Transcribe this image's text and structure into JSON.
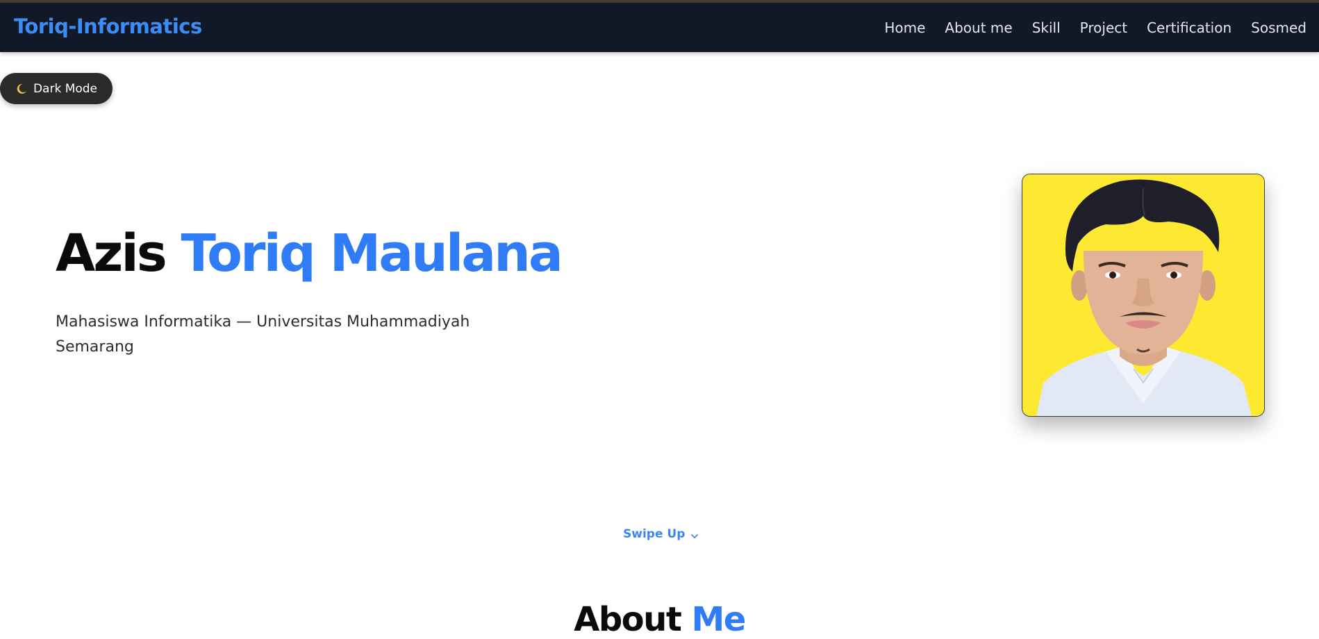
{
  "navbar": {
    "brand": "Toriq-Informatics",
    "links": [
      "Home",
      "About me",
      "Skill",
      "Project",
      "Certification",
      "Sosmed"
    ]
  },
  "theme_toggle": {
    "label": "Dark Mode",
    "icon": "moon-icon"
  },
  "hero": {
    "first_name": "Azis",
    "last_name": "Toriq Maulana",
    "subtitle": "Mahasiswa Informatika — Universitas Muhammadiyah Semarang",
    "photo_icon": "profile-photo"
  },
  "swipe": {
    "label": "Swipe Up",
    "icon": "chevron-down-icon"
  },
  "about": {
    "title_part1": "About",
    "title_part2": "Me"
  },
  "colors": {
    "accent": "#2f7cf6",
    "navbar_bg": "#111827",
    "photo_bg": "#fde832"
  }
}
